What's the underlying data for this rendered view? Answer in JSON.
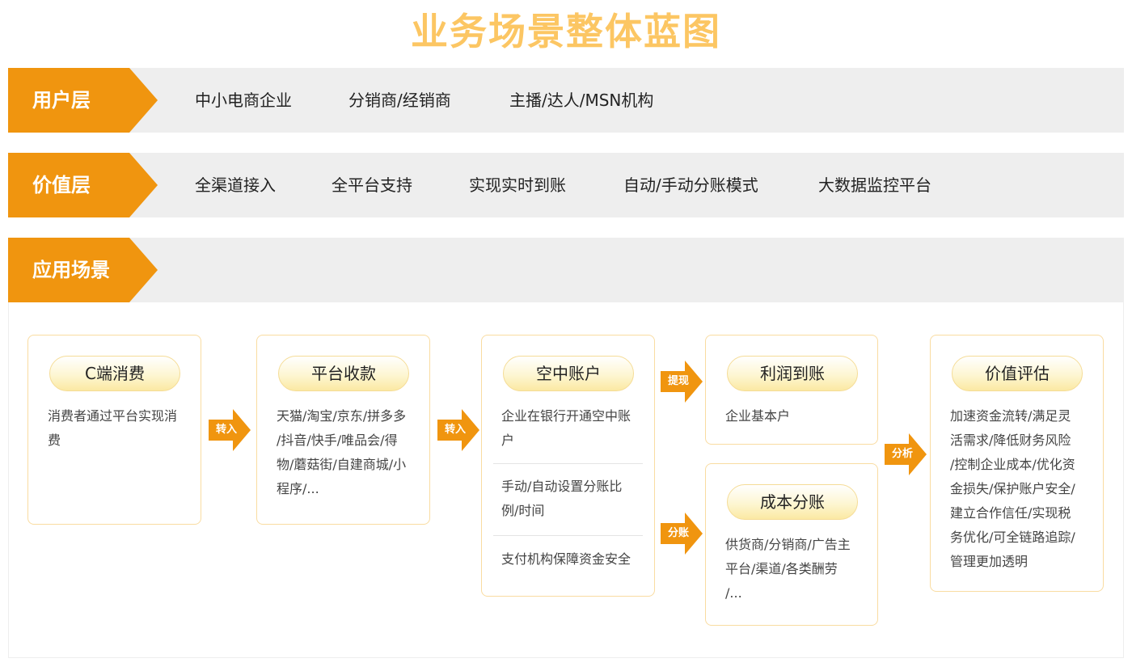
{
  "page_title": "业务场景整体蓝图",
  "colors": {
    "accent": "#f0950f",
    "title": "#fcc663",
    "band": "#eeeeee",
    "card_border": "#f9dca1"
  },
  "user_layer": {
    "label": "用户层",
    "items": [
      "中小电商企业",
      "分销商/经销商",
      "主播/达人/MSN机构"
    ]
  },
  "value_layer": {
    "label": "价值层",
    "items": [
      "全渠道接入",
      "全平台支持",
      "实现实时到账",
      "自动/手动分账模式",
      "大数据监控平台"
    ]
  },
  "scenario": {
    "label": "应用场景",
    "cards": {
      "c_consume": {
        "title": "C端消费",
        "text": [
          "消费者通过平台实现消",
          "费"
        ]
      },
      "platform": {
        "title": "平台收款",
        "text": [
          "天猫/淘宝/京东/拼多多",
          "/抖音/快手/唯品会/得",
          "物/蘑菇街/自建商城/小",
          "程序/..."
        ]
      },
      "virtual": {
        "title": "空中账户",
        "sections": [
          [
            "企业在银行开通空中账",
            "户"
          ],
          [
            "手动/自动设置分账比",
            "例/时间"
          ],
          [
            "支付机构保障资金安全"
          ]
        ]
      },
      "profit": {
        "title": "利润到账",
        "text": [
          "企业基本户"
        ]
      },
      "cost": {
        "title": "成本分账",
        "text": [
          "供货商/分销商/广告主",
          "平台/渠道/各类酬劳",
          "/..."
        ]
      },
      "value": {
        "title": "价值评估",
        "text": [
          "加速资金流转/满足灵",
          "活需求/降低财务风险",
          "/控制企业成本/优化资",
          "金损失/保护账户安全/",
          "建立合作信任/实现税",
          "务优化/可全链路追踪/",
          "管理更加透明"
        ]
      }
    },
    "arrows": {
      "a1": "转入",
      "a2": "转入",
      "withdraw": "提现",
      "split": "分账",
      "analyze": "分析"
    }
  }
}
